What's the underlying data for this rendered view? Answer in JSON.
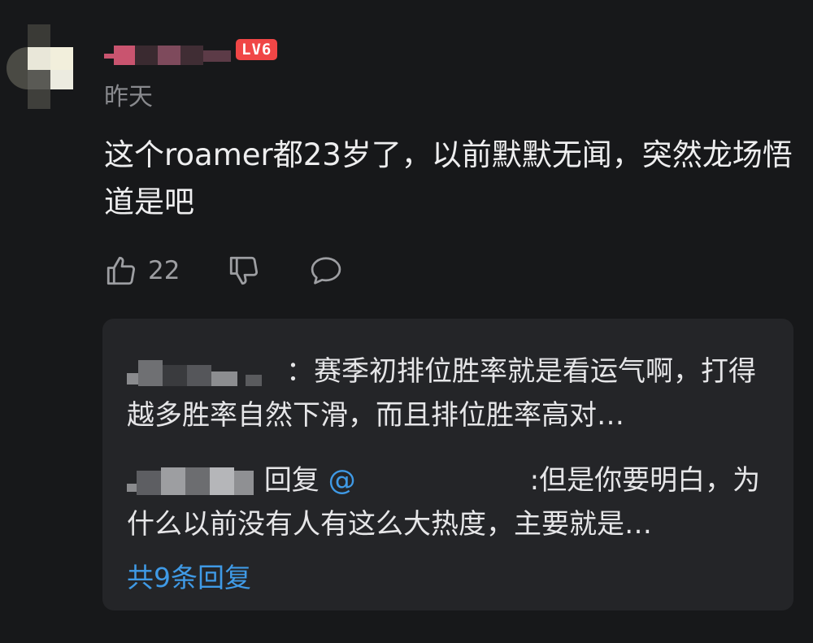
{
  "comment": {
    "level_badge": "LV6",
    "timestamp": "昨天",
    "text": "这个roamer都23岁了，以前默默无闻，突然龙场悟道是吧",
    "like_count": "22",
    "icons": {
      "like": "thumbs-up-icon",
      "dislike": "thumbs-down-icon",
      "reply": "comment-bubble-icon"
    }
  },
  "replies": [
    {
      "text": "：赛季初排位胜率就是看运气啊，打得越多胜率自然下滑，而且排位胜率高对…"
    },
    {
      "reply_word": "回复",
      "mention_prefix": "@",
      "text": ":但是你要明白，为什么以前没有人有这么大热度，主要就是…"
    }
  ],
  "view_all_replies": "共9条回复",
  "colors": {
    "background": "#17181a",
    "reply_box": "#242528",
    "accent": "#3f9ae6",
    "badge": "#f04646"
  }
}
